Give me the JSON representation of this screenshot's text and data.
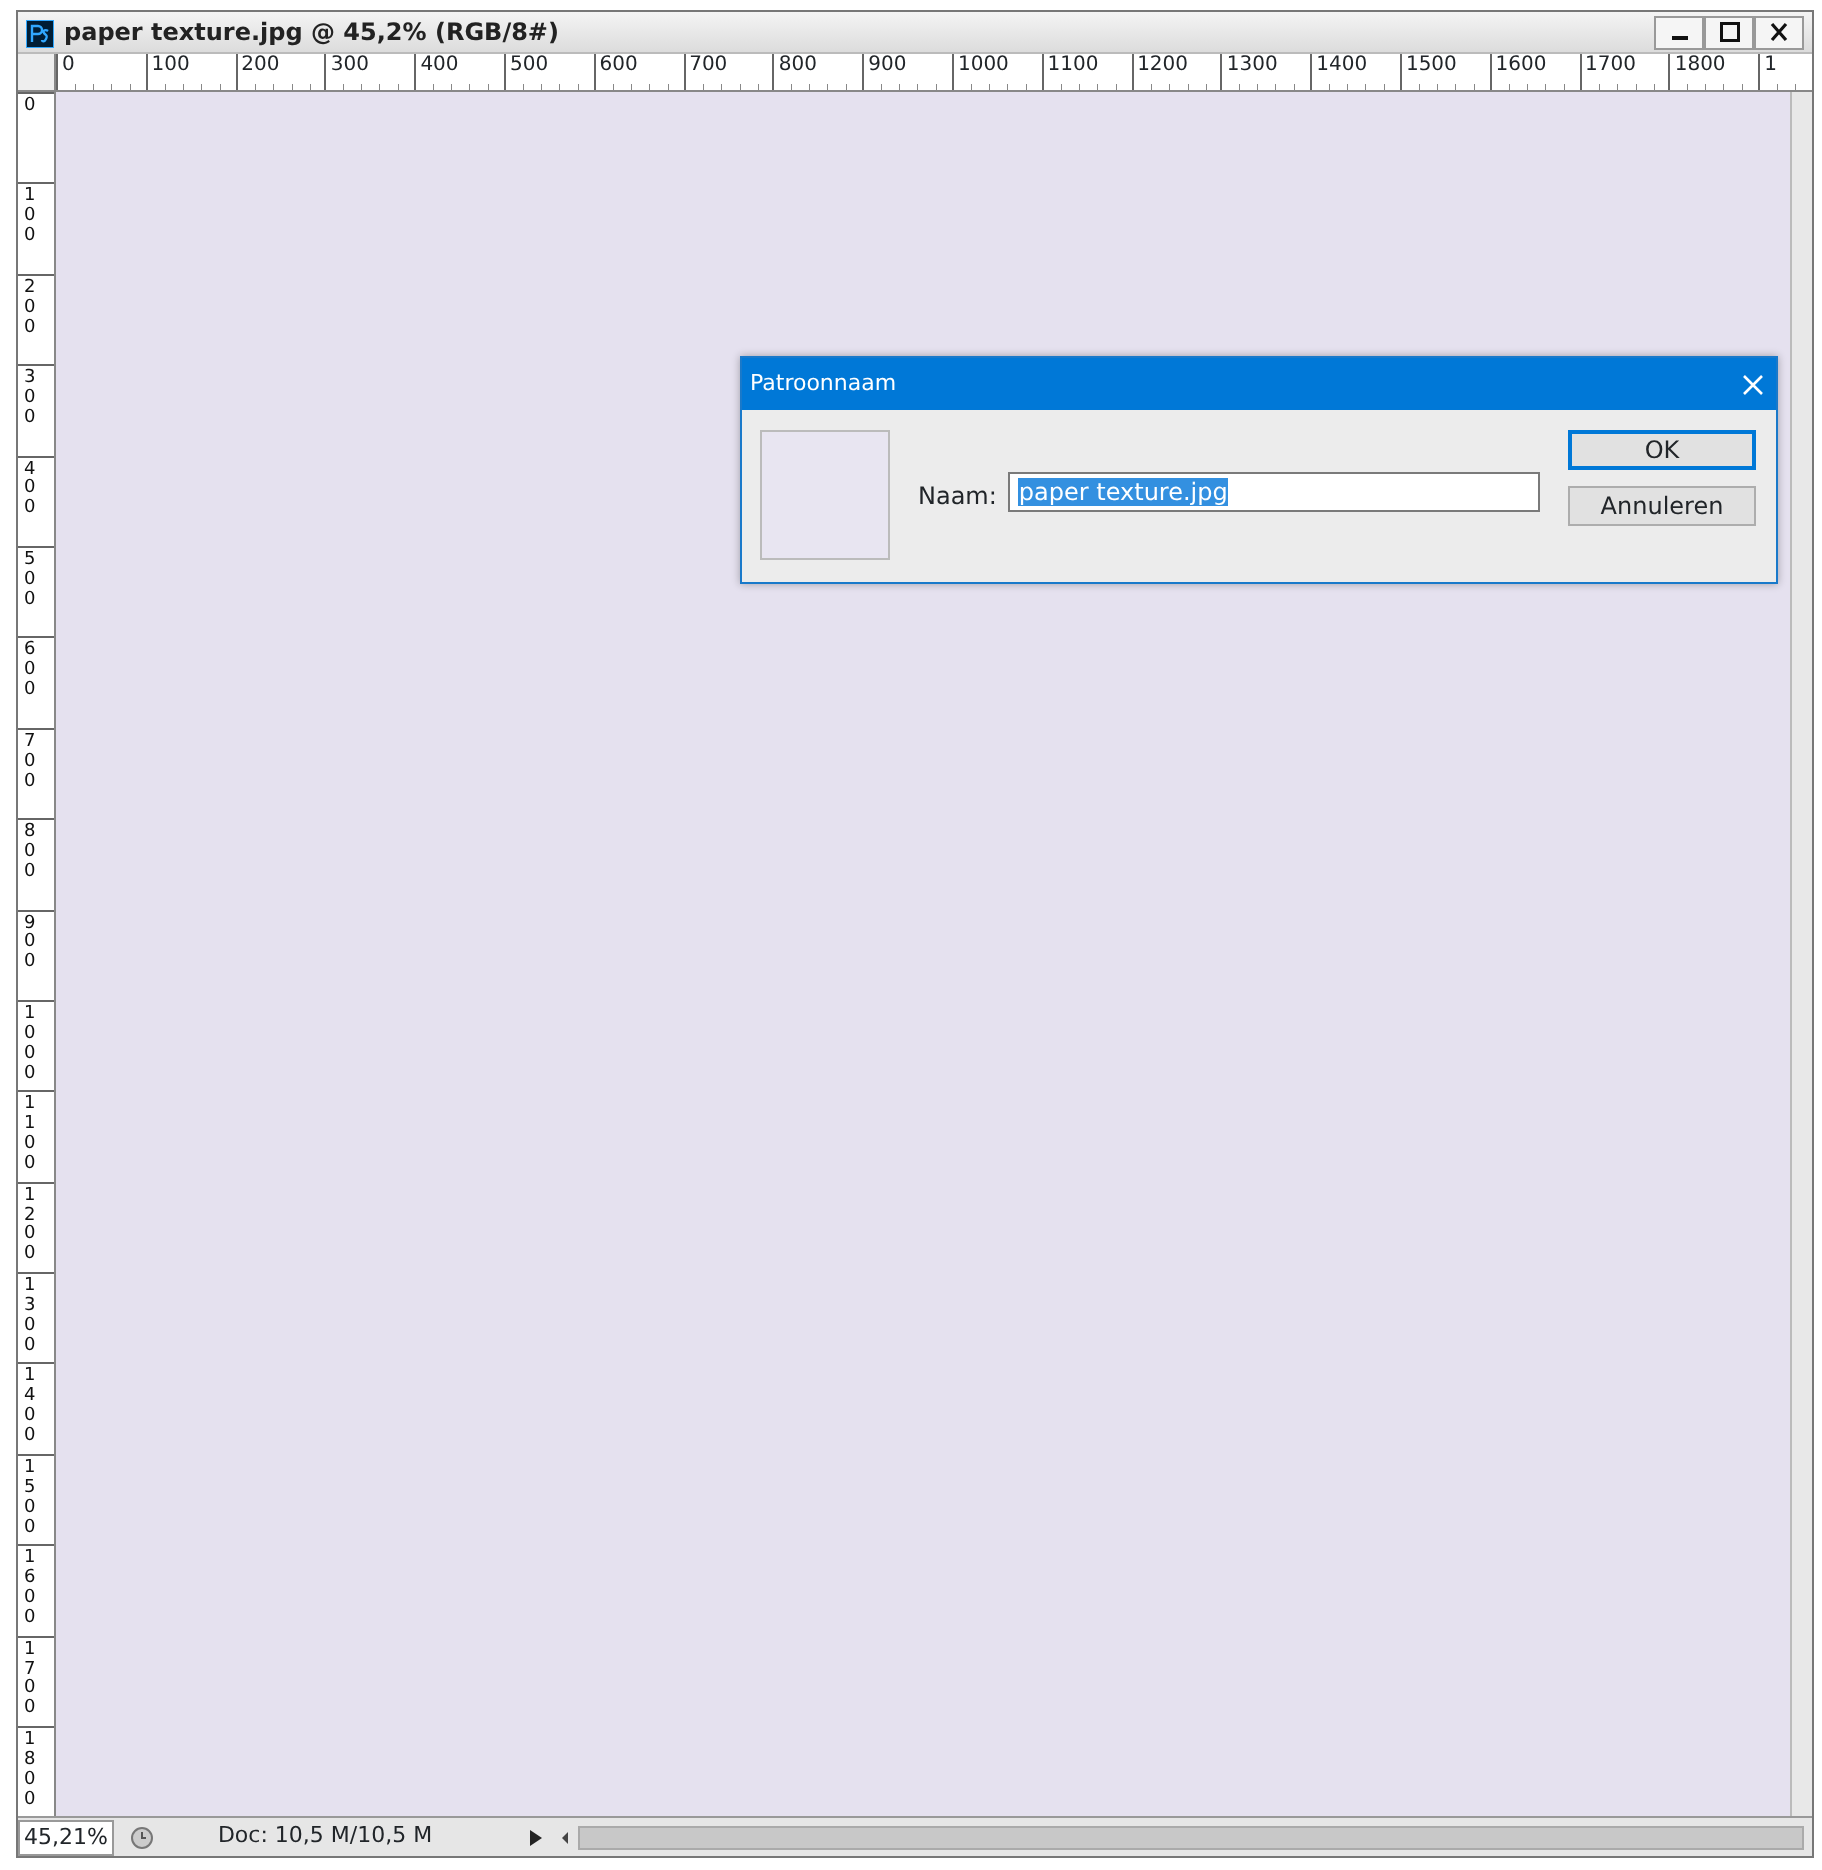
{
  "window": {
    "title": "paper texture.jpg @ 45,2% (RGB/8#)"
  },
  "rulers": {
    "horizontal": [
      "0",
      "100",
      "200",
      "300",
      "400",
      "500",
      "600",
      "700",
      "800",
      "900",
      "1000",
      "1100",
      "1200",
      "1300",
      "1400",
      "1500",
      "1600",
      "1700",
      "1800",
      "1"
    ],
    "vertical": [
      "0",
      "100",
      "200",
      "300",
      "400",
      "500",
      "600",
      "700",
      "800",
      "900",
      "1000",
      "1100",
      "1200",
      "1300",
      "1400",
      "1500",
      "1600",
      "1700",
      "1800"
    ]
  },
  "dialog": {
    "title": "Patroonnaam",
    "field": {
      "label": "Naam:",
      "value": "paper texture.jpg",
      "selected": true
    },
    "buttons": [
      {
        "label": "OK",
        "default": true
      },
      {
        "label": "Annuleren",
        "default": false
      }
    ]
  },
  "status_bar": {
    "zoom": "45,21%",
    "doc": "Doc: 10,5 M/10,5 M"
  }
}
